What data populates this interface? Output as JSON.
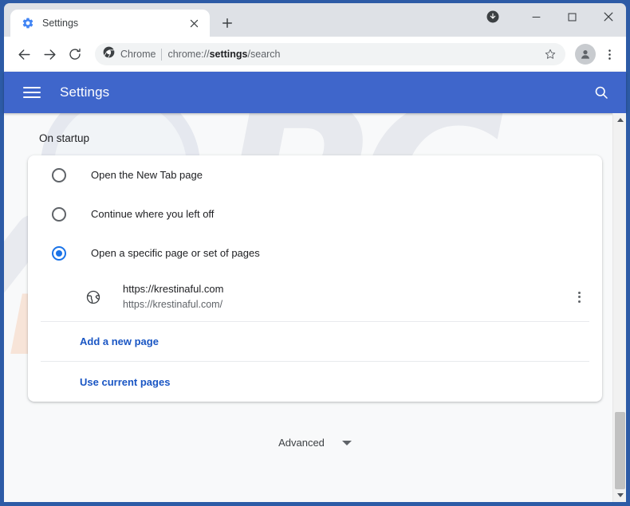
{
  "window": {
    "controls": {
      "download_icon": "download-badge-icon",
      "minimize_label": "Minimize",
      "maximize_label": "Maximize",
      "close_label": "Close"
    }
  },
  "tabstrip": {
    "tabs": [
      {
        "title": "Settings",
        "favicon": "settings-gear-icon",
        "close_label": "Close tab",
        "active": true
      }
    ],
    "new_tab_label": "New tab"
  },
  "toolbar": {
    "back_label": "Back",
    "forward_label": "Forward",
    "reload_label": "Reload",
    "omnibox": {
      "chip_icon": "chrome-logo-icon",
      "chip_label": "Chrome",
      "url_prefix": "chrome://",
      "url_bold": "settings",
      "url_suffix": "/search",
      "full_url": "chrome://settings/search"
    },
    "bookmark_label": "Bookmark this tab",
    "profile_label": "Profile",
    "menu_label": "Customize and control Google Chrome"
  },
  "appbar": {
    "menu_icon": "hamburger-menu-icon",
    "title": "Settings",
    "search_icon": "search-icon",
    "background_color": "#3f66cb"
  },
  "watermark": {
    "brand_primary": "PC",
    "brand_secondary": "risk.com",
    "glass_icon": "magnifying-glass-watermark"
  },
  "page": {
    "section_title": "On startup",
    "startup_options": [
      {
        "label": "Open the New Tab page",
        "selected": false
      },
      {
        "label": "Continue where you left off",
        "selected": false
      },
      {
        "label": "Open a specific page or set of pages",
        "selected": true
      }
    ],
    "startup_pages": [
      {
        "icon": "globe-icon",
        "title": "https://krestinaful.com",
        "url": "https://krestinaful.com/",
        "more_label": "More actions"
      }
    ],
    "actions": [
      {
        "label": "Add a new page"
      },
      {
        "label": "Use current pages"
      }
    ],
    "advanced": {
      "label": "Advanced",
      "chevron_icon": "chevron-down-icon"
    },
    "link_color": "#1a56c4",
    "accent_color": "#1a73e8"
  },
  "scrollbar": {
    "up_icon": "scroll-up-arrow-icon",
    "down_icon": "scroll-down-arrow-icon",
    "thumb_label": "Vertical scrollbar thumb"
  }
}
